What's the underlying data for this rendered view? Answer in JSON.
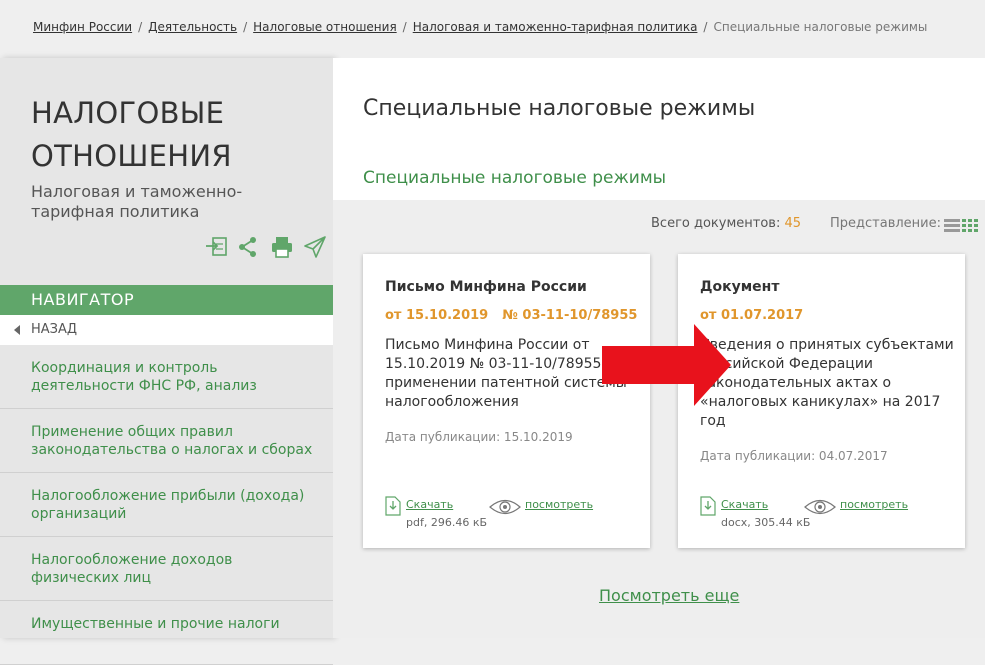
{
  "breadcrumb": {
    "items": [
      "Минфин России",
      "Деятельность",
      "Налоговые отношения",
      "Налоговая и таможенно-тарифная политика"
    ],
    "separator": "/",
    "current": "Специальные налоговые режимы"
  },
  "sidebar": {
    "title_line1": "НАЛОГОВЫЕ",
    "title_line2": "ОТНОШЕНИЯ",
    "subtitle": "Налоговая и таможенно-тарифная политика",
    "share_icons": [
      "subscribe-icon",
      "share-icon",
      "print-icon",
      "send-icon"
    ],
    "nav_header": "НАВИГАТОР",
    "back_label": "НАЗАД",
    "items": [
      "Координация и контроль деятельности ФНС РФ, анализ",
      "Применение общих правил законодательства о налогах и сборах",
      "Налогообложение прибыли (дохода) организаций",
      "Налогообложение доходов физических лиц",
      "Имущественные и прочие налоги"
    ]
  },
  "main": {
    "page_title": "Специальные налоговые режимы",
    "section_title": "Специальные налоговые режимы",
    "doc_count_label": "Всего документов:",
    "doc_count": "45",
    "view_label": "Представление:",
    "more_link": "Посмотреть еще"
  },
  "cards": [
    {
      "title": "Письмо Минфина России",
      "date": "от 15.10.2019",
      "number": "№ 03-11-10/78955",
      "description": "Письмо Минфина России от 15.10.2019 № 03-11-10/78955 О применении патентной системы налогообложения",
      "pub_date": "Дата публикации: 15.10.2019",
      "download_label": "Скачать",
      "file_info": "pdf, 296.46 кБ",
      "view_label": "посмотреть"
    },
    {
      "title": "Документ",
      "date": "от 01.07.2017",
      "number": "",
      "description": "Сведения о принятых субъектами Российской Федерации законодательных актах о «налоговых каникулах» на 2017 год",
      "pub_date": "Дата публикации: 04.07.2017",
      "download_label": "Скачать",
      "file_info": "docx, 305.44 кБ",
      "view_label": "посмотреть"
    }
  ],
  "colors": {
    "accent_green": "#60a66a",
    "link_green": "#3f8f4a",
    "orange": "#e0962c",
    "arrow_red": "#e8121c"
  }
}
